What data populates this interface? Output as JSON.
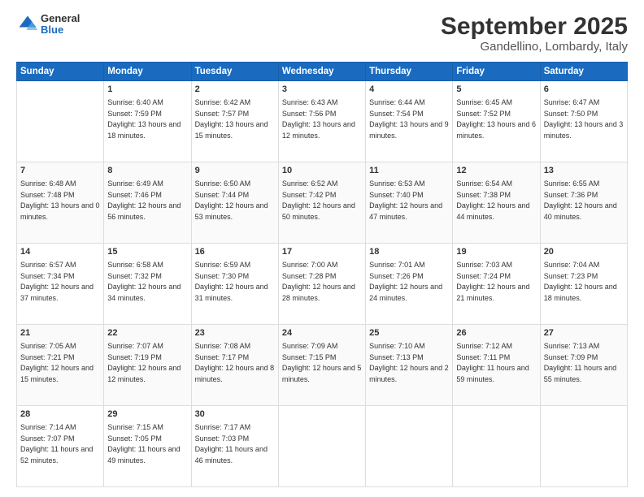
{
  "header": {
    "logo": {
      "general": "General",
      "blue": "Blue"
    },
    "title": "September 2025",
    "subtitle": "Gandellino, Lombardy, Italy"
  },
  "days_of_week": [
    "Sunday",
    "Monday",
    "Tuesday",
    "Wednesday",
    "Thursday",
    "Friday",
    "Saturday"
  ],
  "weeks": [
    [
      {
        "day": "",
        "sunrise": "",
        "sunset": "",
        "daylight": ""
      },
      {
        "day": "1",
        "sunrise": "Sunrise: 6:40 AM",
        "sunset": "Sunset: 7:59 PM",
        "daylight": "Daylight: 13 hours and 18 minutes."
      },
      {
        "day": "2",
        "sunrise": "Sunrise: 6:42 AM",
        "sunset": "Sunset: 7:57 PM",
        "daylight": "Daylight: 13 hours and 15 minutes."
      },
      {
        "day": "3",
        "sunrise": "Sunrise: 6:43 AM",
        "sunset": "Sunset: 7:56 PM",
        "daylight": "Daylight: 13 hours and 12 minutes."
      },
      {
        "day": "4",
        "sunrise": "Sunrise: 6:44 AM",
        "sunset": "Sunset: 7:54 PM",
        "daylight": "Daylight: 13 hours and 9 minutes."
      },
      {
        "day": "5",
        "sunrise": "Sunrise: 6:45 AM",
        "sunset": "Sunset: 7:52 PM",
        "daylight": "Daylight: 13 hours and 6 minutes."
      },
      {
        "day": "6",
        "sunrise": "Sunrise: 6:47 AM",
        "sunset": "Sunset: 7:50 PM",
        "daylight": "Daylight: 13 hours and 3 minutes."
      }
    ],
    [
      {
        "day": "7",
        "sunrise": "Sunrise: 6:48 AM",
        "sunset": "Sunset: 7:48 PM",
        "daylight": "Daylight: 13 hours and 0 minutes."
      },
      {
        "day": "8",
        "sunrise": "Sunrise: 6:49 AM",
        "sunset": "Sunset: 7:46 PM",
        "daylight": "Daylight: 12 hours and 56 minutes."
      },
      {
        "day": "9",
        "sunrise": "Sunrise: 6:50 AM",
        "sunset": "Sunset: 7:44 PM",
        "daylight": "Daylight: 12 hours and 53 minutes."
      },
      {
        "day": "10",
        "sunrise": "Sunrise: 6:52 AM",
        "sunset": "Sunset: 7:42 PM",
        "daylight": "Daylight: 12 hours and 50 minutes."
      },
      {
        "day": "11",
        "sunrise": "Sunrise: 6:53 AM",
        "sunset": "Sunset: 7:40 PM",
        "daylight": "Daylight: 12 hours and 47 minutes."
      },
      {
        "day": "12",
        "sunrise": "Sunrise: 6:54 AM",
        "sunset": "Sunset: 7:38 PM",
        "daylight": "Daylight: 12 hours and 44 minutes."
      },
      {
        "day": "13",
        "sunrise": "Sunrise: 6:55 AM",
        "sunset": "Sunset: 7:36 PM",
        "daylight": "Daylight: 12 hours and 40 minutes."
      }
    ],
    [
      {
        "day": "14",
        "sunrise": "Sunrise: 6:57 AM",
        "sunset": "Sunset: 7:34 PM",
        "daylight": "Daylight: 12 hours and 37 minutes."
      },
      {
        "day": "15",
        "sunrise": "Sunrise: 6:58 AM",
        "sunset": "Sunset: 7:32 PM",
        "daylight": "Daylight: 12 hours and 34 minutes."
      },
      {
        "day": "16",
        "sunrise": "Sunrise: 6:59 AM",
        "sunset": "Sunset: 7:30 PM",
        "daylight": "Daylight: 12 hours and 31 minutes."
      },
      {
        "day": "17",
        "sunrise": "Sunrise: 7:00 AM",
        "sunset": "Sunset: 7:28 PM",
        "daylight": "Daylight: 12 hours and 28 minutes."
      },
      {
        "day": "18",
        "sunrise": "Sunrise: 7:01 AM",
        "sunset": "Sunset: 7:26 PM",
        "daylight": "Daylight: 12 hours and 24 minutes."
      },
      {
        "day": "19",
        "sunrise": "Sunrise: 7:03 AM",
        "sunset": "Sunset: 7:24 PM",
        "daylight": "Daylight: 12 hours and 21 minutes."
      },
      {
        "day": "20",
        "sunrise": "Sunrise: 7:04 AM",
        "sunset": "Sunset: 7:23 PM",
        "daylight": "Daylight: 12 hours and 18 minutes."
      }
    ],
    [
      {
        "day": "21",
        "sunrise": "Sunrise: 7:05 AM",
        "sunset": "Sunset: 7:21 PM",
        "daylight": "Daylight: 12 hours and 15 minutes."
      },
      {
        "day": "22",
        "sunrise": "Sunrise: 7:07 AM",
        "sunset": "Sunset: 7:19 PM",
        "daylight": "Daylight: 12 hours and 12 minutes."
      },
      {
        "day": "23",
        "sunrise": "Sunrise: 7:08 AM",
        "sunset": "Sunset: 7:17 PM",
        "daylight": "Daylight: 12 hours and 8 minutes."
      },
      {
        "day": "24",
        "sunrise": "Sunrise: 7:09 AM",
        "sunset": "Sunset: 7:15 PM",
        "daylight": "Daylight: 12 hours and 5 minutes."
      },
      {
        "day": "25",
        "sunrise": "Sunrise: 7:10 AM",
        "sunset": "Sunset: 7:13 PM",
        "daylight": "Daylight: 12 hours and 2 minutes."
      },
      {
        "day": "26",
        "sunrise": "Sunrise: 7:12 AM",
        "sunset": "Sunset: 7:11 PM",
        "daylight": "Daylight: 11 hours and 59 minutes."
      },
      {
        "day": "27",
        "sunrise": "Sunrise: 7:13 AM",
        "sunset": "Sunset: 7:09 PM",
        "daylight": "Daylight: 11 hours and 55 minutes."
      }
    ],
    [
      {
        "day": "28",
        "sunrise": "Sunrise: 7:14 AM",
        "sunset": "Sunset: 7:07 PM",
        "daylight": "Daylight: 11 hours and 52 minutes."
      },
      {
        "day": "29",
        "sunrise": "Sunrise: 7:15 AM",
        "sunset": "Sunset: 7:05 PM",
        "daylight": "Daylight: 11 hours and 49 minutes."
      },
      {
        "day": "30",
        "sunrise": "Sunrise: 7:17 AM",
        "sunset": "Sunset: 7:03 PM",
        "daylight": "Daylight: 11 hours and 46 minutes."
      },
      {
        "day": "",
        "sunrise": "",
        "sunset": "",
        "daylight": ""
      },
      {
        "day": "",
        "sunrise": "",
        "sunset": "",
        "daylight": ""
      },
      {
        "day": "",
        "sunrise": "",
        "sunset": "",
        "daylight": ""
      },
      {
        "day": "",
        "sunrise": "",
        "sunset": "",
        "daylight": ""
      }
    ]
  ]
}
